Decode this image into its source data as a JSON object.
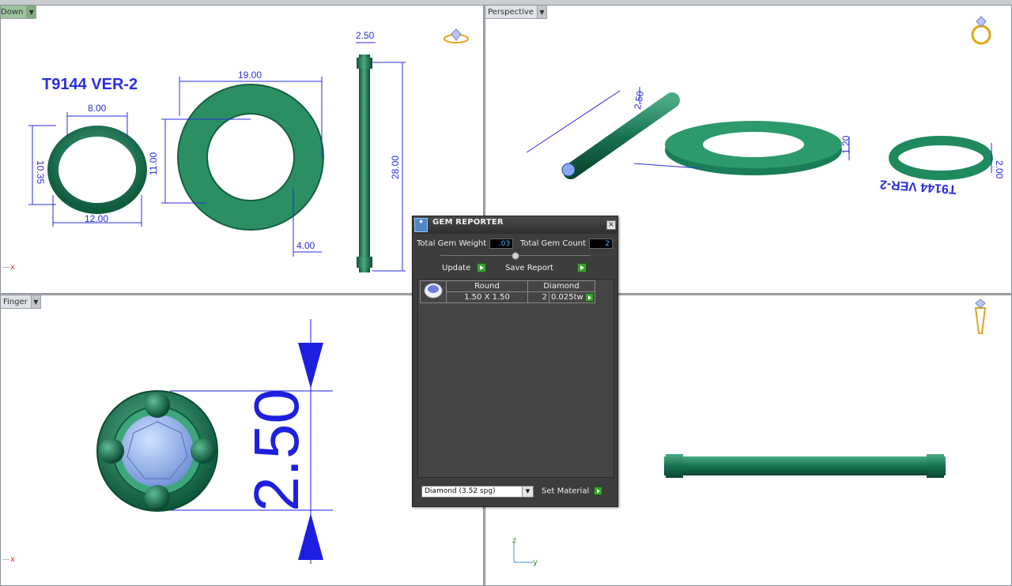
{
  "viewports": {
    "top_left": {
      "label": "Down",
      "title_text": "T9144 VER-2",
      "dims": {
        "ring_width": "8.00",
        "ring_height": "10.35",
        "ring_bottom": "12.00",
        "washer_width": "19.00",
        "washer_height": "11.00",
        "washer_thick": "4.00",
        "rod_width": "2.50",
        "rod_length": "28.00"
      },
      "axis": "x"
    },
    "top_right": {
      "label": "Perspective",
      "labels": {
        "rod": "2.50",
        "washer_h": "1.20",
        "ring_h": "2.00",
        "mirrored": "T9144 VER-2"
      }
    },
    "bottom_left": {
      "label": "Finger",
      "dim": "2.50",
      "axis": "x"
    },
    "bottom_right": {
      "axis_z": "z",
      "axis_y": "y"
    }
  },
  "gem_reporter": {
    "title": "GEM REPORTER",
    "total_weight_label": "Total Gem Weight",
    "total_weight_value": ".03",
    "total_count_label": "Total Gem Count",
    "total_count_value": "2",
    "update_label": "Update",
    "save_report_label": "Save Report",
    "table": {
      "col_shape": "Round",
      "col_material": "Diamond",
      "size": "1.50 X 1.50",
      "count": "2",
      "weight": "0.025tw"
    },
    "material_select": "Diamond     (3.52 spg)",
    "set_material_label": "Set Material"
  },
  "colors": {
    "model_green": "#16714f",
    "dim_blue": "#1d1fe0",
    "panel": "#3d3d3d"
  }
}
